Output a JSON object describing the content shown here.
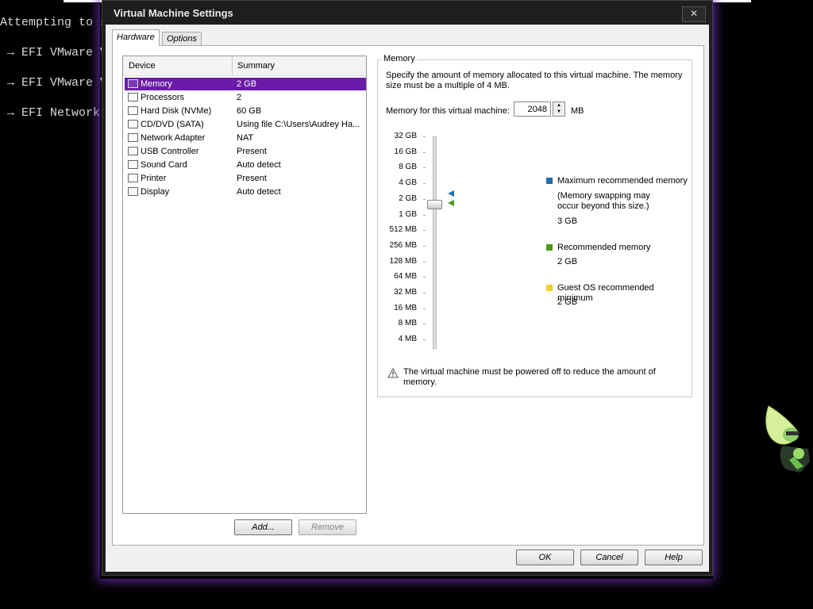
{
  "terminal": {
    "line1": "Attempting to st",
    "line2": " → EFI VMware Vi",
    "line3": " → EFI VMware Vi",
    "line4": " → EFI Network.."
  },
  "window": {
    "title": "Virtual Machine Settings",
    "close_glyph": "✕"
  },
  "tabs": [
    {
      "label": "Hardware"
    },
    {
      "label": "Options"
    }
  ],
  "devices": {
    "col_device": "Device",
    "col_summary": "Summary",
    "rows": [
      {
        "name": "Memory",
        "summary": "2 GB",
        "icon": "memory-icon"
      },
      {
        "name": "Processors",
        "summary": "2",
        "icon": "processor-icon"
      },
      {
        "name": "Hard Disk (NVMe)",
        "summary": "60 GB",
        "icon": "hard-disk-icon"
      },
      {
        "name": "CD/DVD (SATA)",
        "summary": "Using file C:\\Users\\Audrey Ha...",
        "icon": "cd-dvd-icon"
      },
      {
        "name": "Network Adapter",
        "summary": "NAT",
        "icon": "network-adapter-icon"
      },
      {
        "name": "USB Controller",
        "summary": "Present",
        "icon": "usb-controller-icon"
      },
      {
        "name": "Sound Card",
        "summary": "Auto detect",
        "icon": "sound-card-icon"
      },
      {
        "name": "Printer",
        "summary": "Present",
        "icon": "printer-icon"
      },
      {
        "name": "Display",
        "summary": "Auto detect",
        "icon": "display-icon"
      }
    ],
    "add_label": "Add...",
    "remove_label": "Remove"
  },
  "memory": {
    "group_title": "Memory",
    "description": "Specify the amount of memory allocated to this virtual machine. The memory size must be a multiple of 4 MB.",
    "field_label": "Memory for this virtual machine:",
    "value": "2048",
    "unit": "MB",
    "scale": [
      "32 GB",
      "16 GB",
      "8 GB",
      "4 GB",
      "2 GB",
      "1 GB",
      "512 MB",
      "256 MB",
      "128 MB",
      "64 MB",
      "32 MB",
      "16 MB",
      "8 MB",
      "4 MB"
    ],
    "legend": {
      "max_title": "Maximum recommended memory",
      "max_note": "(Memory swapping may occur beyond this size.)",
      "max_value": "3 GB",
      "rec_title": "Recommended memory",
      "rec_value": "2 GB",
      "guest_title": "Guest OS recommended minimum",
      "guest_value": "2 GB"
    },
    "colors": {
      "max": "#1f6fb0",
      "rec": "#4a9a1a",
      "guest": "#f0d020"
    },
    "warning": "The virtual machine must be powered off to reduce the amount of memory."
  },
  "footer": {
    "ok": "OK",
    "cancel": "Cancel",
    "help": "Help"
  }
}
